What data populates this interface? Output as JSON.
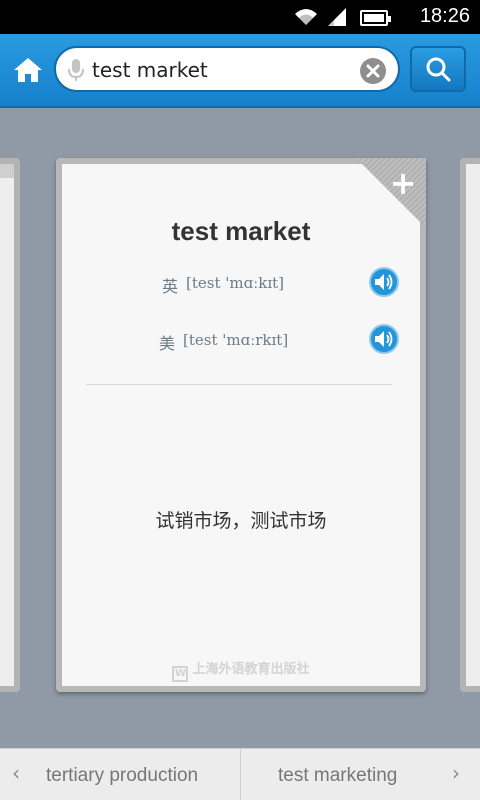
{
  "status_bar": {
    "time": "18:26",
    "icons": [
      "wifi-icon",
      "signal-icon",
      "battery-icon"
    ]
  },
  "header": {
    "search_value": "test market",
    "search_placeholder": "",
    "accent_color": "#1a88d4"
  },
  "card": {
    "word": "test market",
    "pronunciations": [
      {
        "label": "英",
        "ipa": "[test 'mɑːkɪt]"
      },
      {
        "label": "美",
        "ipa": "[test 'mɑːrkɪt]"
      }
    ],
    "definition": "试销市场，测试市场",
    "publisher": "上海外语教育出版社",
    "add_label": "+"
  },
  "bottom_nav": {
    "prev_word": "tertiary production",
    "next_word": "test marketing",
    "prev_arrow": "‹",
    "next_arrow": "›"
  }
}
